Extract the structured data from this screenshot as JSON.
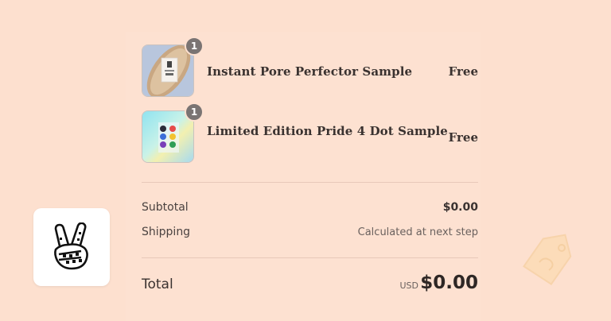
{
  "order_summary": {
    "items": [
      {
        "name": "Instant Pore Perfector Sample",
        "quantity": "1",
        "price": "Free",
        "thumbnail_icon": "pore-perfector-sample-icon"
      },
      {
        "name": "Limited Edition Pride 4 Dot Sample",
        "quantity": "1",
        "price": "Free",
        "thumbnail_icon": "pride-dot-sample-icon"
      }
    ],
    "subtotal": {
      "label": "Subtotal",
      "value": "$0.00"
    },
    "shipping": {
      "label": "Shipping",
      "value": "Calculated at next step"
    },
    "total": {
      "label": "Total",
      "currency": "USD",
      "value": "$0.00"
    }
  },
  "brand": {
    "logo_icon": "peace-hand-logo-icon"
  },
  "decor": {
    "icon": "price-tag-icon"
  },
  "colors": {
    "background": "#fde0cf",
    "text": "#3a3230",
    "badge": "#7a7473"
  }
}
